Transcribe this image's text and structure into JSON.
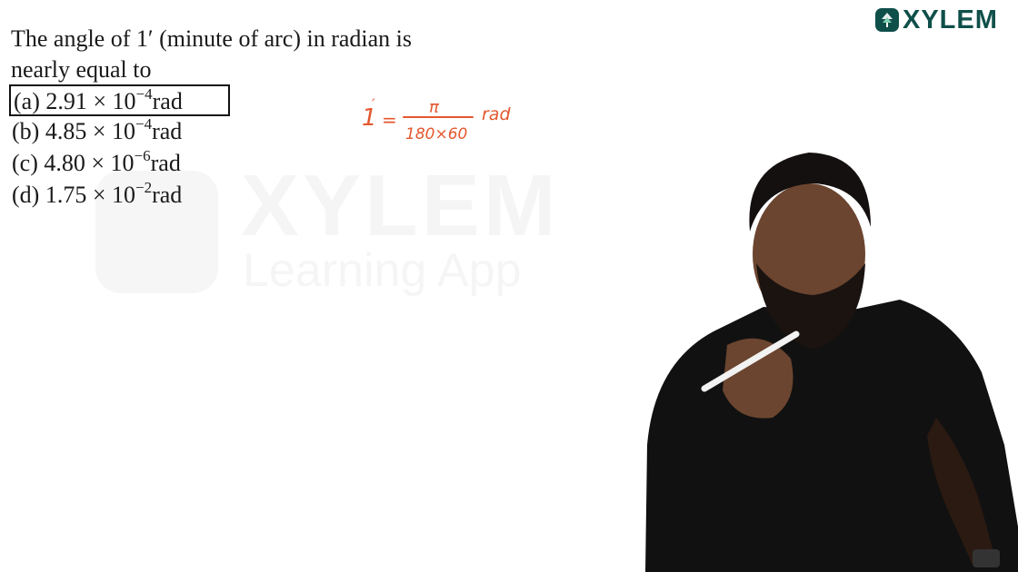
{
  "brand": {
    "name": "XYLEM",
    "accent": "#0f4f4a"
  },
  "watermark": {
    "title": "XYLEM",
    "subtitle": "Learning App"
  },
  "question": {
    "line1": "The angle of 1′ (minute of arc) in radian is",
    "line2": "nearly equal to"
  },
  "options": [
    {
      "label": "(a) 2.91 × 10",
      "exp": "−4",
      "unit": "rad",
      "selected": true
    },
    {
      "label": "(b) 4.85 × 10",
      "exp": "−4",
      "unit": "rad",
      "selected": false
    },
    {
      "label": "(c) 4.80 × 10",
      "exp": "−6",
      "unit": "rad",
      "selected": false
    },
    {
      "label": "(d) 1.75 × 10",
      "exp": "−2",
      "unit": "rad",
      "selected": false
    }
  ],
  "annotation": {
    "lhs": "1",
    "prime": "′",
    "equals": "=",
    "numerator": "π",
    "denominator": "180×60",
    "unit": "rad",
    "color": "#e4572e"
  }
}
